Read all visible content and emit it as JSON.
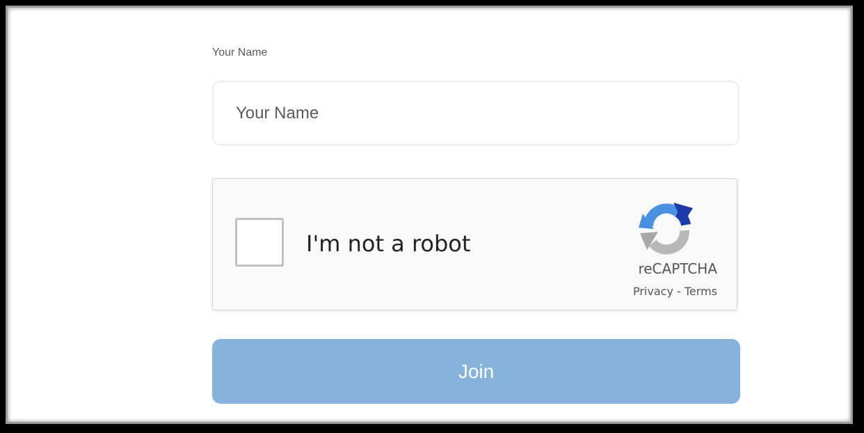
{
  "form": {
    "name_label": "Your Name",
    "name_placeholder": "Your Name",
    "name_value": ""
  },
  "recaptcha": {
    "label": "I'm not a robot",
    "brand": "reCAPTCHA",
    "privacy": "Privacy",
    "separator": " - ",
    "terms": "Terms",
    "checked": false,
    "logo_icon": "recaptcha-logo-icon"
  },
  "join": {
    "label": "Join"
  },
  "colors": {
    "join_button": "#86b3dc",
    "input_border": "#e9edf1",
    "recaptcha_bg": "#f9f9f9"
  }
}
